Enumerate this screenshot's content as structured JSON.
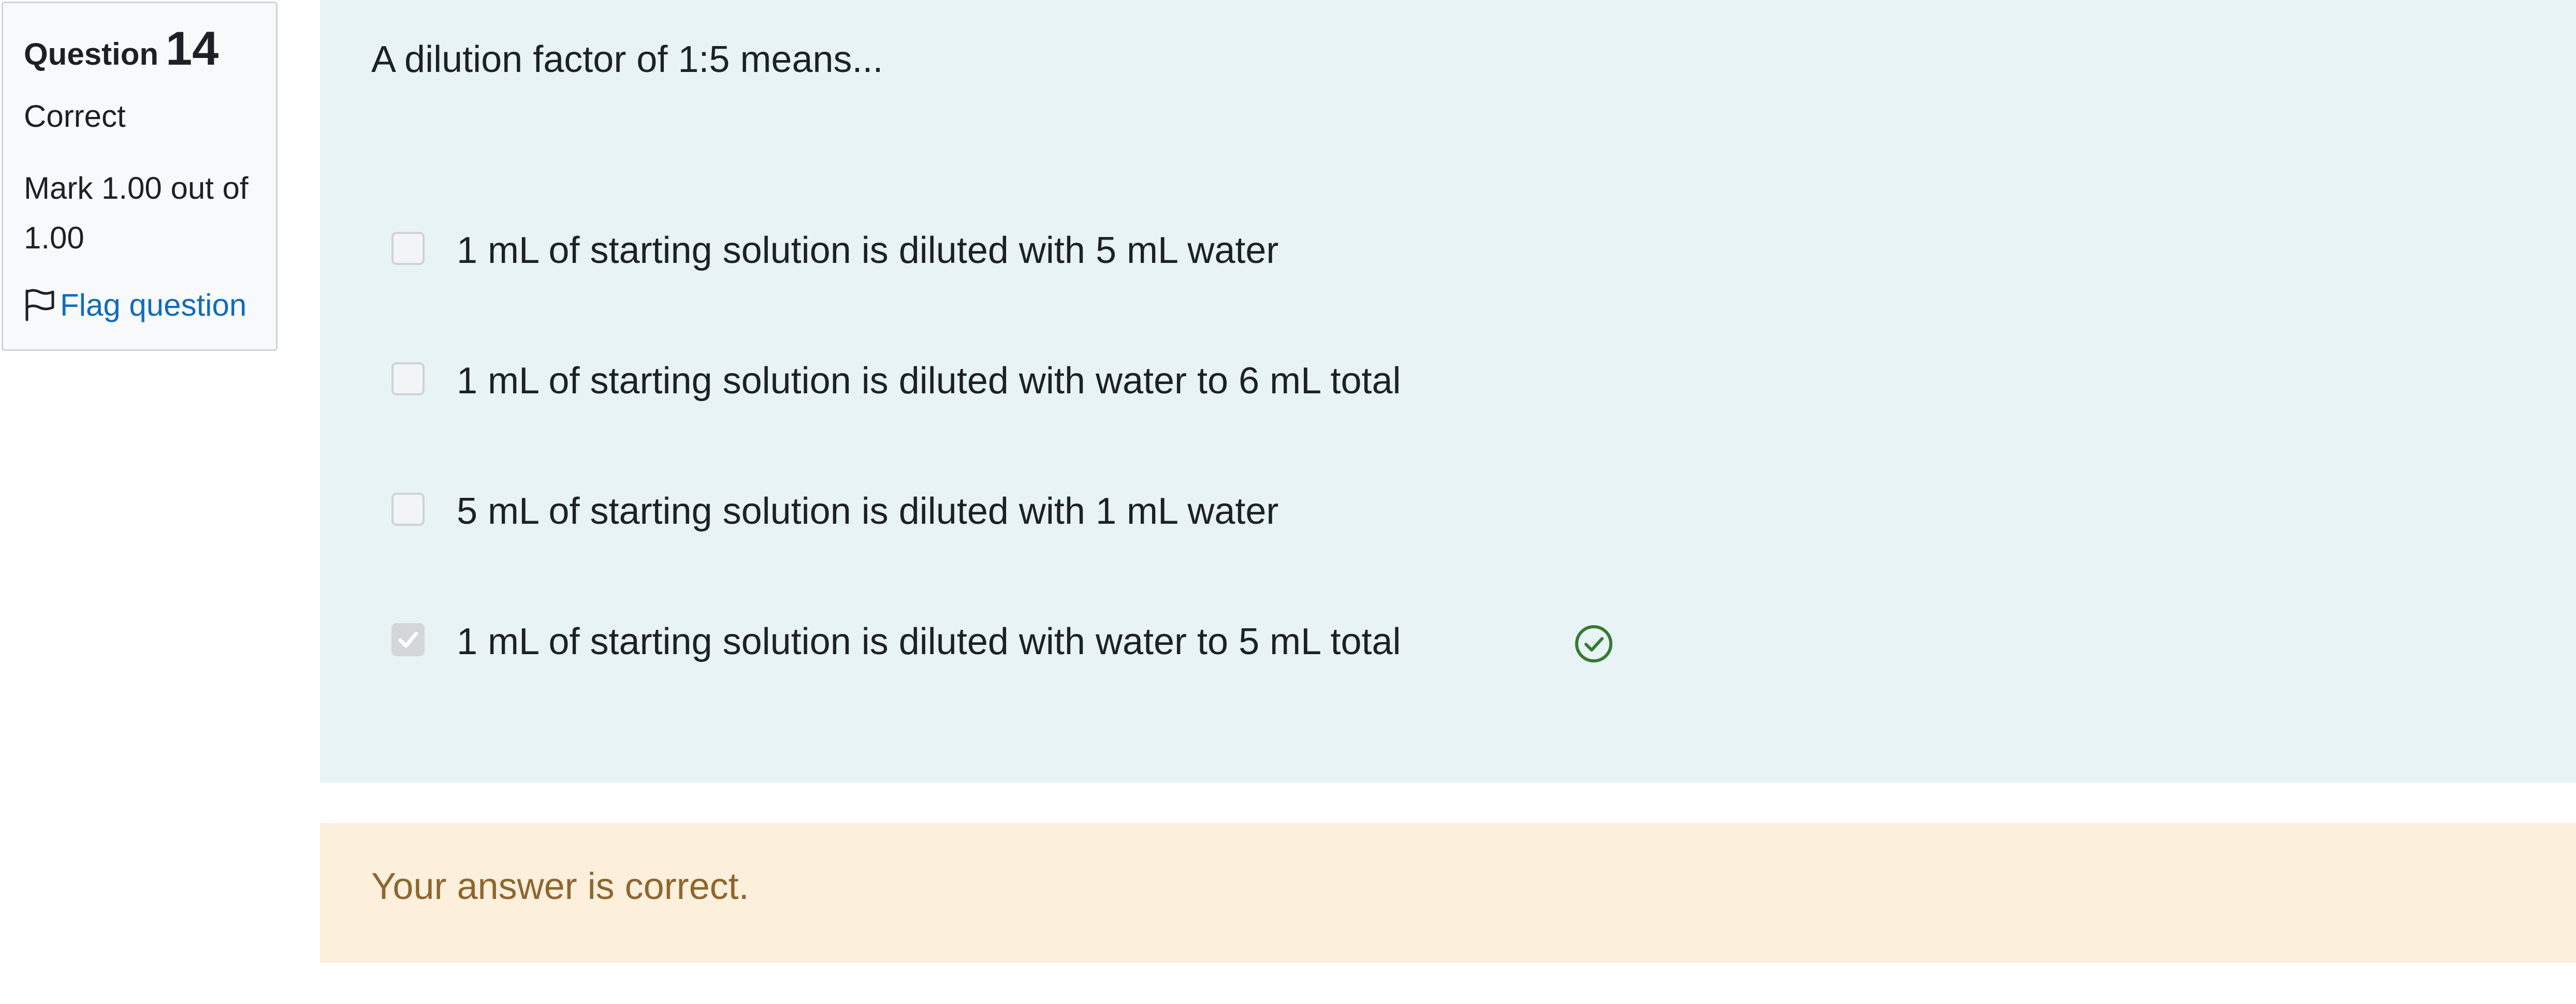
{
  "question_info": {
    "label": "Question",
    "number": "14",
    "state": "Correct",
    "grade": "Mark 1.00 out of 1.00",
    "flag_label": "Flag question",
    "flag_icon": "flag-icon"
  },
  "question": {
    "text": "A dilution factor of 1:5 means...",
    "answers": [
      {
        "label": "1 mL of starting solution is diluted with 5 mL water",
        "checked": false,
        "correct": false
      },
      {
        "label": "1 mL of starting solution is diluted with water to 6 mL total",
        "checked": false,
        "correct": false
      },
      {
        "label": "5 mL of starting solution is diluted with 1 mL water",
        "checked": false,
        "correct": false
      },
      {
        "label": "1 mL of starting solution is diluted with water to 5 mL total",
        "checked": true,
        "correct": true
      }
    ],
    "correct_icon": "check-circle-icon"
  },
  "feedback": {
    "text": "Your answer is correct."
  },
  "colors": {
    "info_bg": "#f8f9fa",
    "content_bg": "#e7f3f5",
    "feedback_bg": "#fcefdc",
    "feedback_text": "#8e662e",
    "link": "#0f6cbf",
    "correct": "#357a32"
  }
}
